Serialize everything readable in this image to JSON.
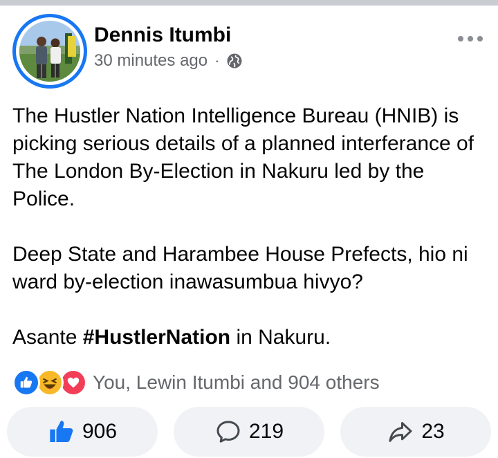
{
  "post": {
    "author": "Dennis Itumbi",
    "timestamp": "30 minutes ago",
    "separator": "·",
    "privacy_icon": "globe-icon",
    "body": {
      "paragraph1": "The Hustler Nation Intelligence Bureau (HNIB) is picking serious details of a planned interferance of The London By-Election in Nakuru led by the Police.",
      "paragraph2": "Deep State and Harambee House Prefects, hio ni ward by-election inawasumbua hivyo?",
      "paragraph3_before": "Asante ",
      "paragraph3_hashtag": "#HustlerNation",
      "paragraph3_after": " in Nakuru."
    }
  },
  "reactions": {
    "icons": [
      "like-reaction-icon",
      "haha-reaction-icon",
      "love-reaction-icon"
    ],
    "summary": "You, Lewin Itumbi and 904 others"
  },
  "actions": {
    "like_count": "906",
    "comment_count": "219",
    "share_count": "23"
  },
  "colors": {
    "accent": "#1877f2",
    "muted_text": "#65676b",
    "button_bg": "#f0f2f5",
    "haha": "#f7b928",
    "love": "#f33e58"
  }
}
